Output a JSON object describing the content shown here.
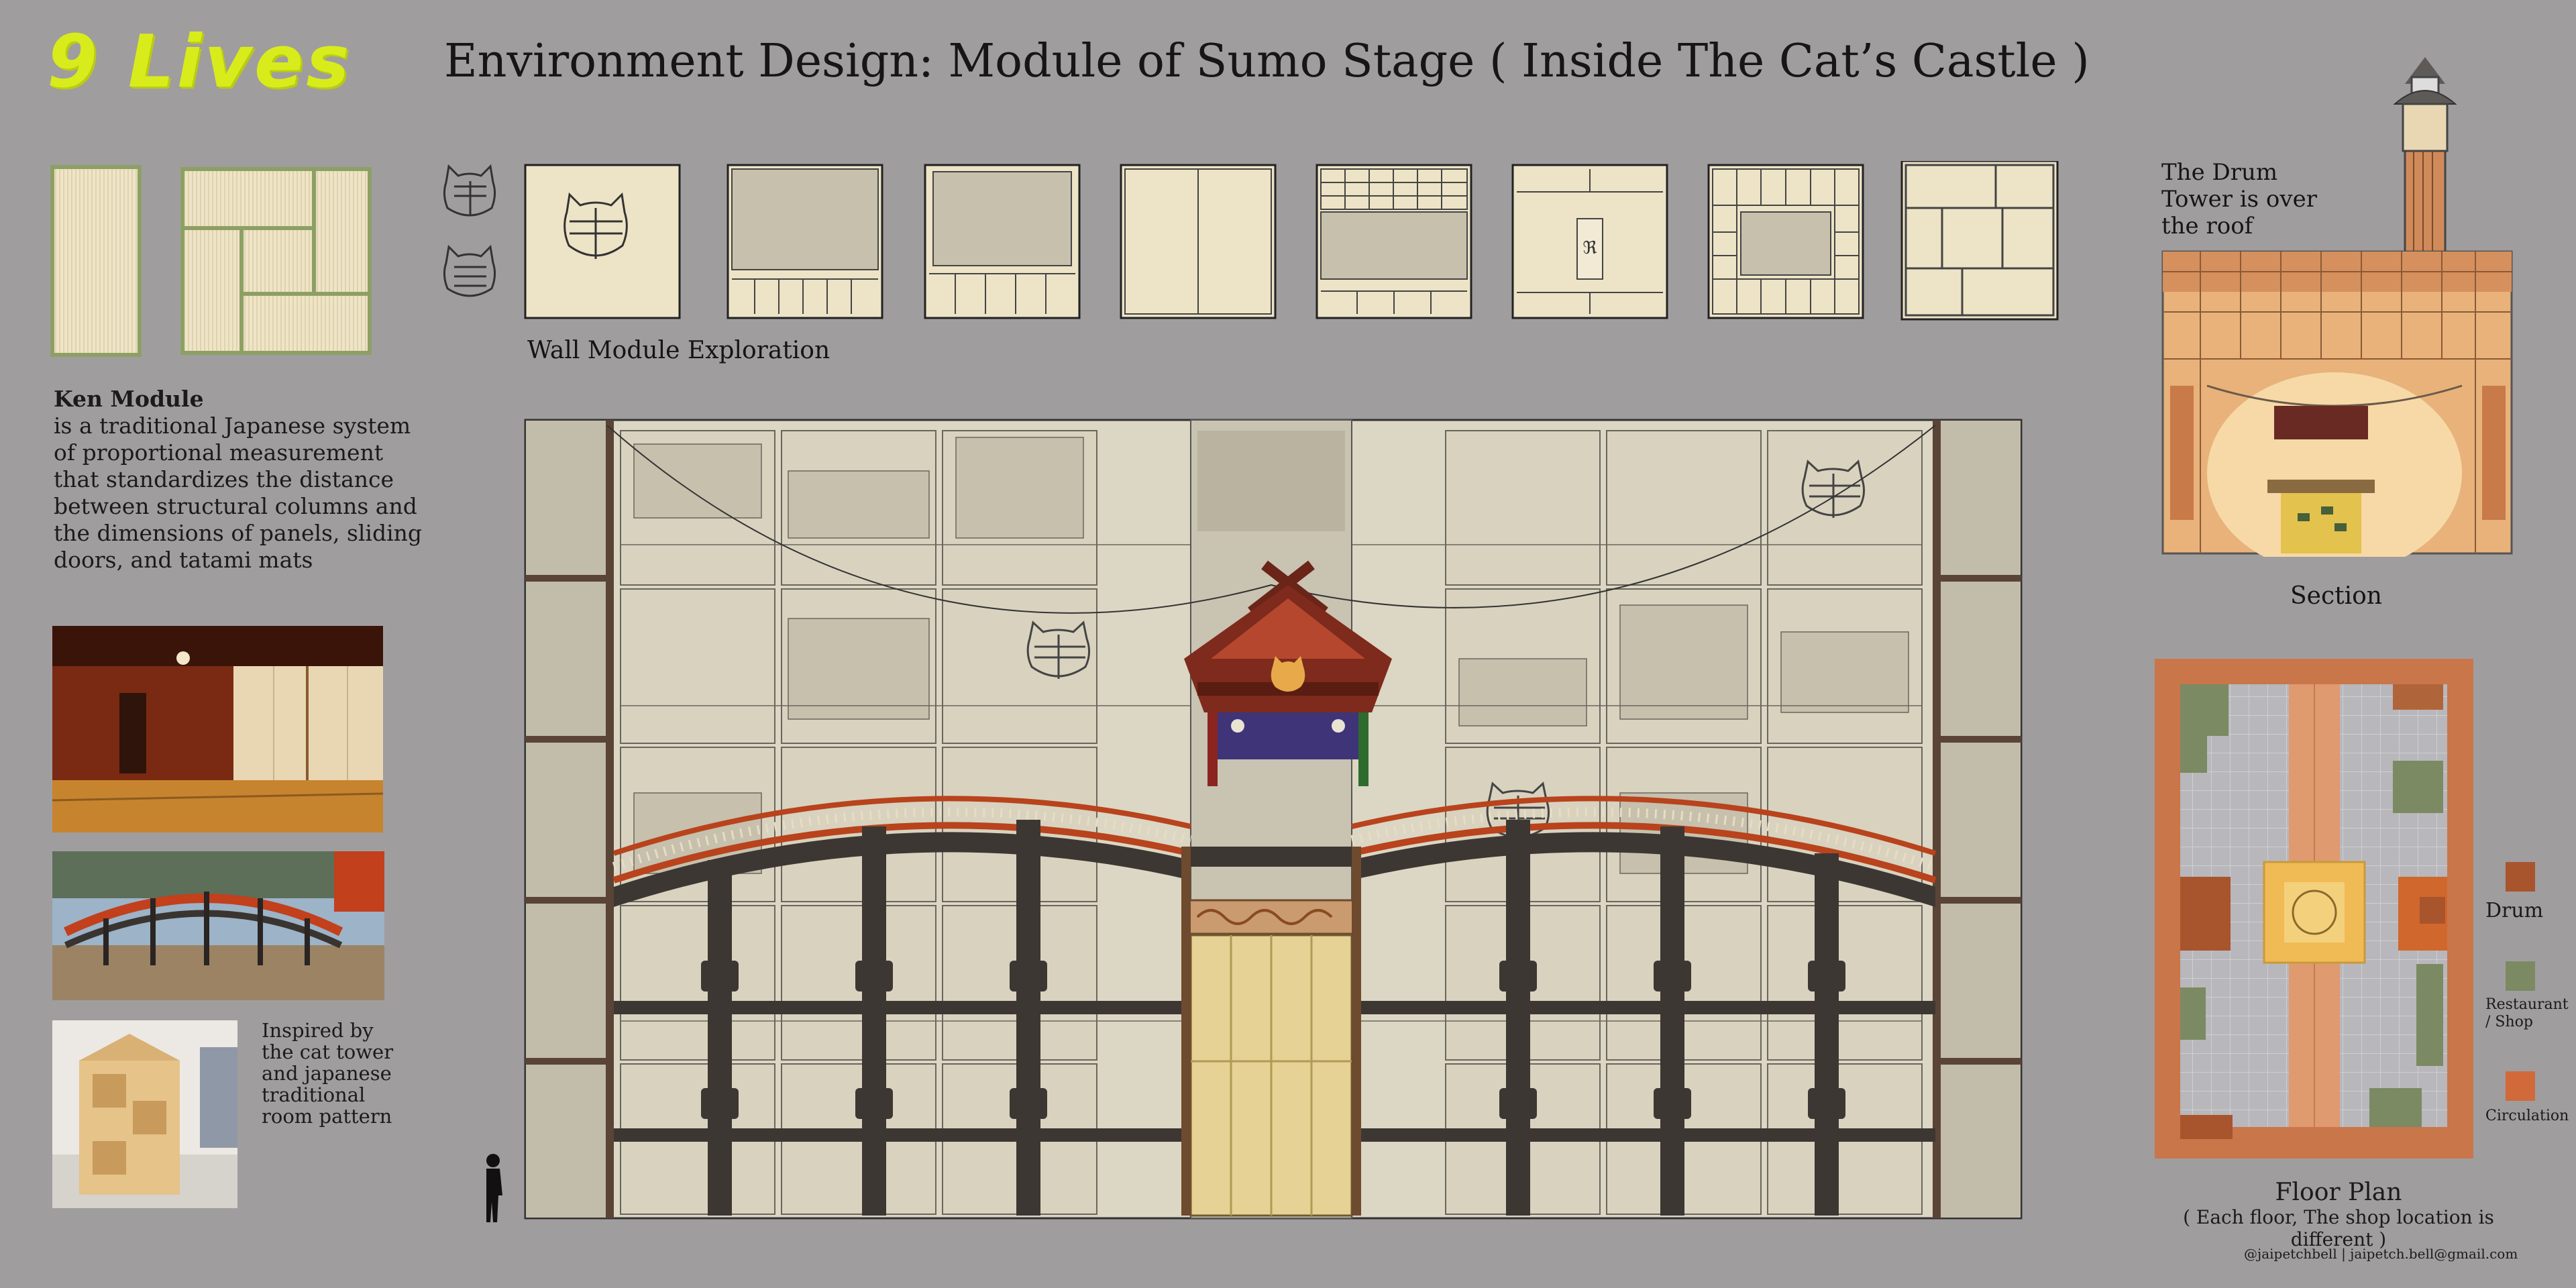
{
  "header": {
    "logo_text": "9 Lives",
    "title": "Environment  Design: Module of Sumo Stage ( Inside The Cat’s Castle )"
  },
  "wall_modules": {
    "caption": "Wall Module Exploration"
  },
  "ken": {
    "heading": "Ken Module",
    "body": "is a traditional Japanese system of proportional measurement that standardizes the distance between structural columns and the dimensions of panels, sliding doors, and tatami mats"
  },
  "inspiration": {
    "text": "Inspired by the cat tower and japanese traditional room pattern"
  },
  "section": {
    "note": "The Drum Tower is over the roof",
    "label": "Section"
  },
  "floor_plan": {
    "title": "Floor Plan",
    "subtitle": "( Each floor, The shop location is different )",
    "legend": [
      {
        "label": "Drum",
        "color": "#a8552e"
      },
      {
        "label": "Restaurant / Shop",
        "color": "#7b8a62"
      },
      {
        "label": "Circulation",
        "color": "#d06a3a"
      }
    ]
  },
  "footer": {
    "credit": "@jaipetchbell | jaipetch.bell@gmail.com"
  },
  "colors": {
    "background": "#a09d9f",
    "logo": "#d8ec1c",
    "panel": "#ede3c6",
    "bridge_red": "#b8431c",
    "column": "#3d3733",
    "plan_orange": "#c9764a"
  }
}
